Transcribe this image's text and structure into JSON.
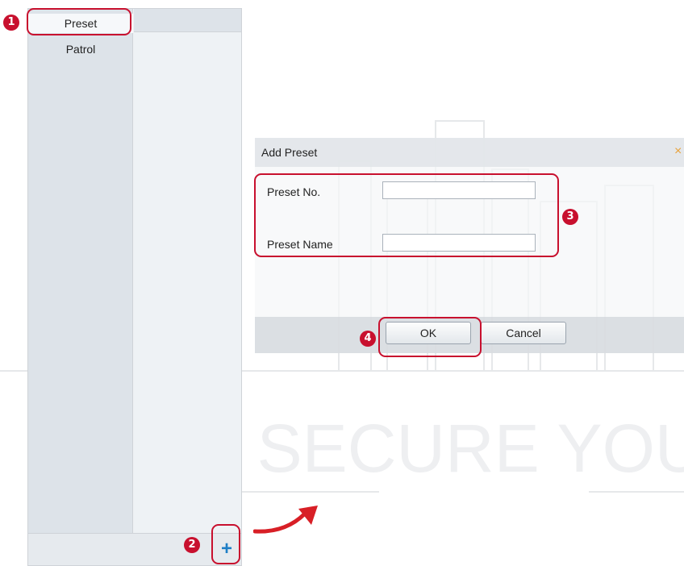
{
  "left_panel": {
    "tabs": [
      {
        "label": "Preset"
      },
      {
        "label": "Patrol"
      }
    ],
    "add_button_label": "+"
  },
  "dialog": {
    "title": "Add Preset",
    "close_label": "×",
    "fields": {
      "preset_no": {
        "label": "Preset No.",
        "value": ""
      },
      "preset_name": {
        "label": "Preset Name",
        "value": ""
      }
    },
    "ok_label": "OK",
    "cancel_label": "Cancel"
  },
  "annotations": {
    "step1": "1",
    "step2": "2",
    "step3": "3",
    "step4": "4",
    "color": "#c8102e"
  },
  "watermark": {
    "line1": "WE SECURE YOU",
    "accent": "#1e7ec6"
  }
}
